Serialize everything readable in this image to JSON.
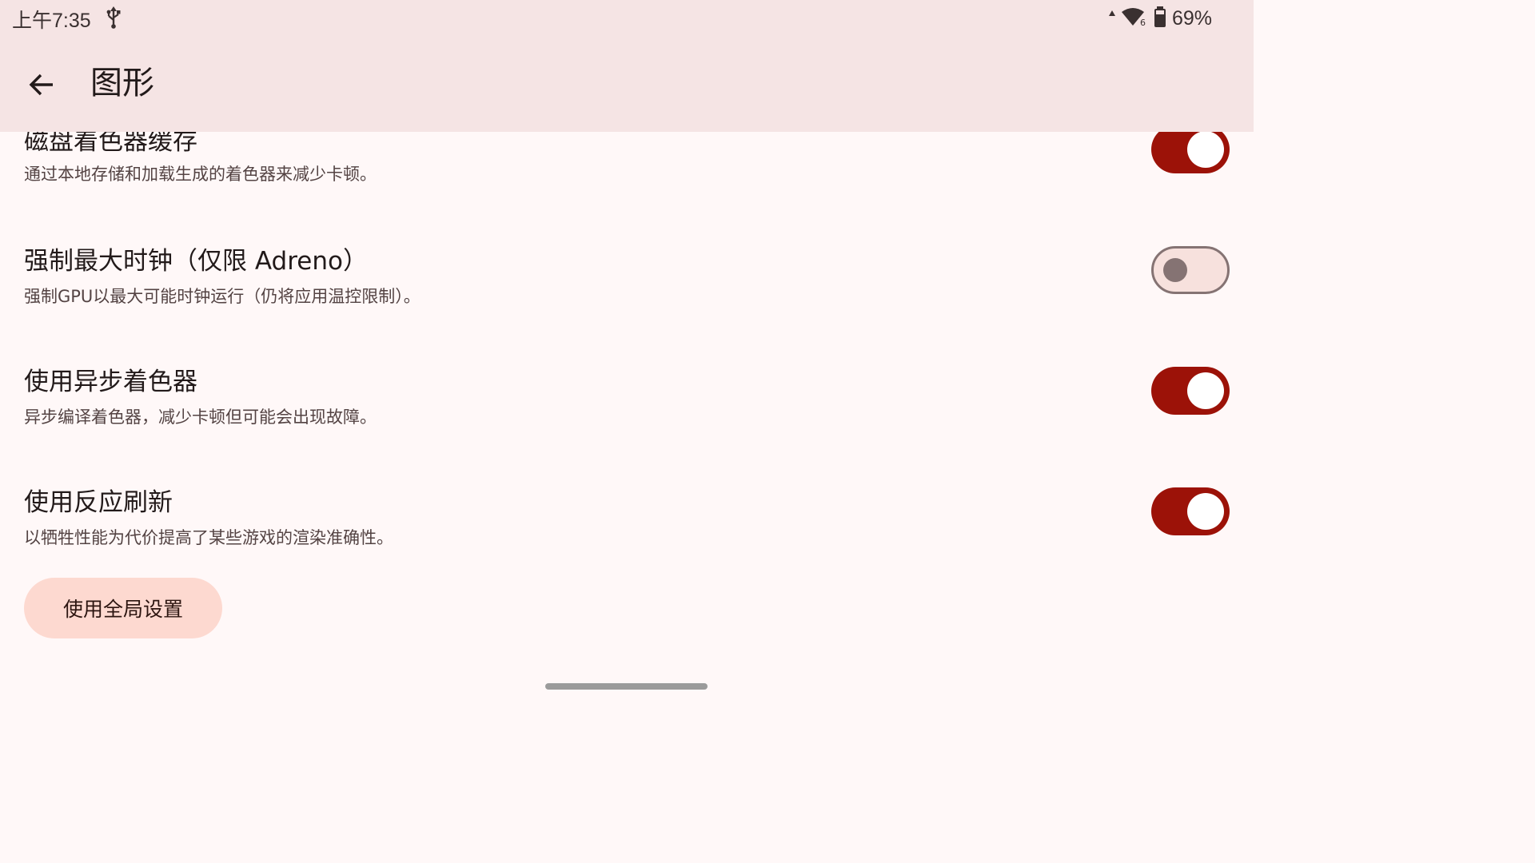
{
  "status_bar": {
    "time": "上午7:35",
    "battery_percent": "69%",
    "icons": [
      "usb-icon",
      "signal-arrow-icon",
      "wifi-icon",
      "battery-icon"
    ]
  },
  "app_bar": {
    "title": "图形",
    "back_icon": "arrow-back-icon"
  },
  "settings": [
    {
      "title": "磁盘着色器缓存",
      "description": "通过本地存储和加载生成的着色器来减少卡顿。",
      "enabled": true
    },
    {
      "title": "强制最大时钟（仅限 Adreno）",
      "description": "强制GPU以最大可能时钟运行（仍将应用温控限制）。",
      "enabled": false
    },
    {
      "title": "使用异步着色器",
      "description": "异步编译着色器，减少卡顿但可能会出现故障。",
      "enabled": true
    },
    {
      "title": "使用反应刷新",
      "description": "以牺牲性能为代价提高了某些游戏的渲染准确性。",
      "enabled": true
    }
  ],
  "global_button_label": "使用全局设置",
  "colors": {
    "accent": "#9c1208",
    "header_bg": "#f5e4e4",
    "background": "#fff8f8",
    "tonal_button": "#fdd9d0"
  }
}
